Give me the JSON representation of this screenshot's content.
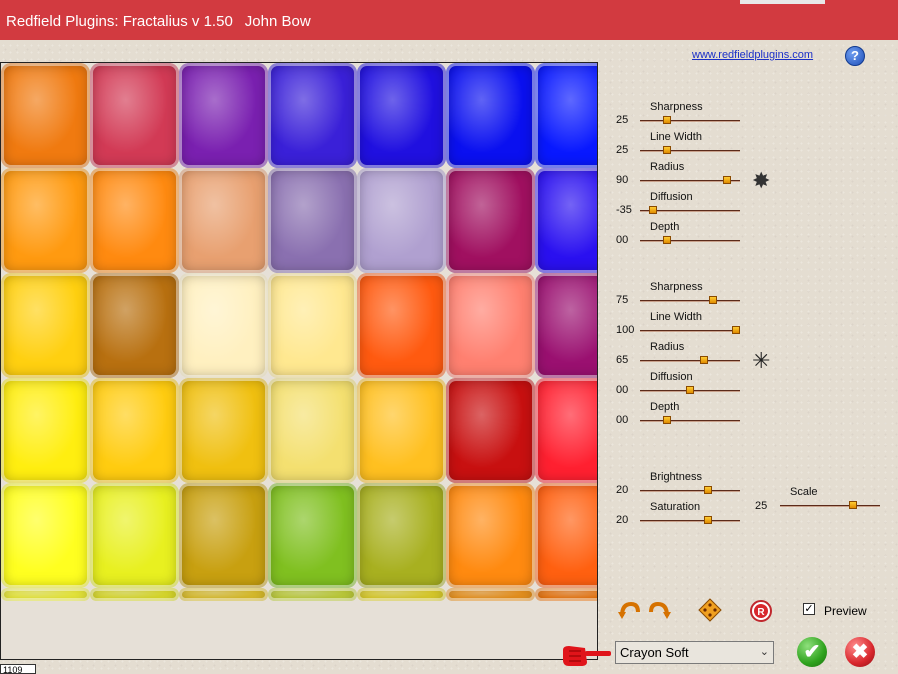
{
  "window": {
    "title": "Redfield Plugins: Fractalius v 1.50",
    "author": "John Bow"
  },
  "link_text": "www.redfieldplugins.com",
  "help_glyph": "?",
  "readout": "1109",
  "sliders": [
    {
      "label": "Sharpness",
      "value": "25",
      "level": 0.25
    },
    {
      "label": "Line Width",
      "value": "25",
      "level": 0.25
    },
    {
      "label": "Radius",
      "value": "90",
      "level": 0.9
    },
    {
      "label": "Diffusion",
      "value": "-35",
      "level": 0.1
    },
    {
      "label": "Depth",
      "value": "00",
      "level": 0.25
    },
    {
      "label": "Sharpness",
      "value": "75",
      "level": 0.75
    },
    {
      "label": "Line Width",
      "value": "100",
      "level": 1.0
    },
    {
      "label": "Radius",
      "value": "65",
      "level": 0.65
    },
    {
      "label": "Diffusion",
      "value": "00",
      "level": 0.5
    },
    {
      "label": "Depth",
      "value": "00",
      "level": 0.25
    },
    {
      "label": "Brightness",
      "value": "20",
      "level": 0.7
    },
    {
      "label": "Saturation",
      "value": "20",
      "level": 0.7
    },
    {
      "label": "Scale",
      "value": "25",
      "level": 0.75
    }
  ],
  "preview_checkbox": {
    "label": "Preview",
    "checked": true
  },
  "preset": {
    "selected": "Crayon Soft"
  },
  "icons": {
    "undo": "undo-arrow-icon",
    "redo": "redo-arrow-icon",
    "randomize": "dice-icon",
    "reset": "reset-icon",
    "ok": "green-check-icon",
    "cancel": "red-close-icon",
    "pointer": "pointing-hand-icon"
  },
  "colors": {
    "titlebar": "#d23a40",
    "ok": "#2fa31e",
    "cancel": "#d8272d"
  }
}
